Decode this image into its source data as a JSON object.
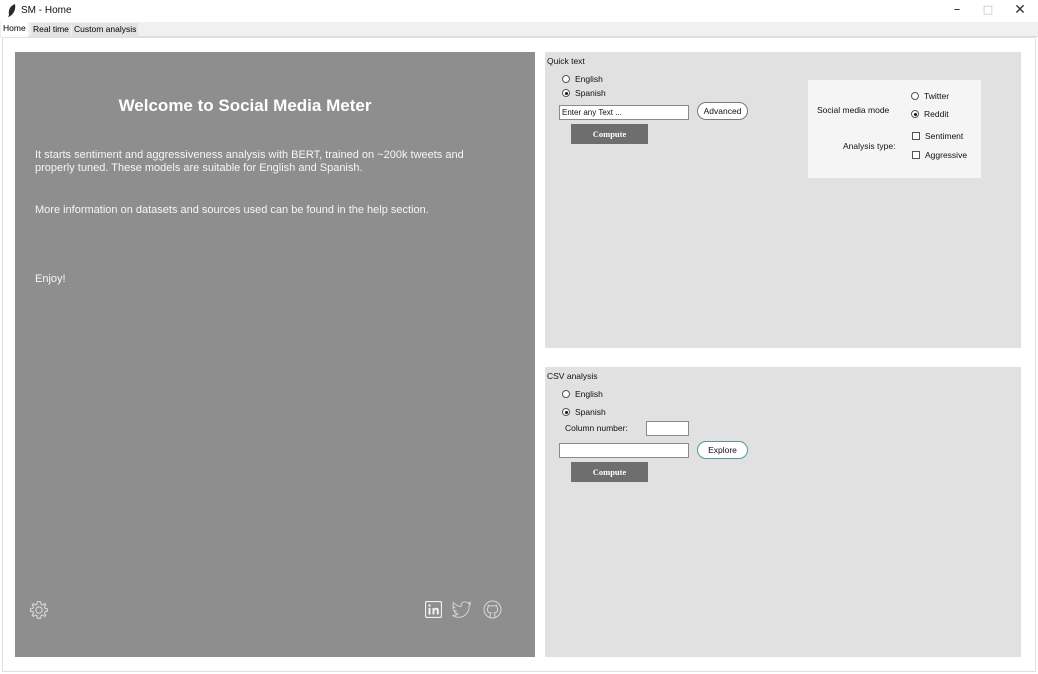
{
  "window": {
    "title": "SM - Home",
    "minimize": "–",
    "maximize": "□",
    "close": "✕"
  },
  "tabs": [
    {
      "label": "Home",
      "active": true
    },
    {
      "label": "Real time",
      "active": false
    },
    {
      "label": "Custom analysis",
      "active": false
    }
  ],
  "welcome": {
    "title": "Welcome to Social Media Meter",
    "paragraph1": "It starts sentiment and aggressiveness analysis with BERT, trained on ~200k tweets and properly tuned. These models are suitable for English and Spanish.",
    "paragraph2": "More information on datasets and sources used can be found in the help section.",
    "paragraph3": "Enjoy!",
    "icons": [
      "gear-icon",
      "linkedin-icon",
      "twitter-icon",
      "github-icon"
    ]
  },
  "quick_text": {
    "label": "Quick text",
    "languages": [
      {
        "label": "English",
        "selected": false
      },
      {
        "label": "Spanish",
        "selected": true
      }
    ],
    "input_value": "Enter any Text ...",
    "advanced_label": "Advanced",
    "compute_label": "Compute",
    "options": {
      "social_media_mode_label": "Social media mode",
      "modes": [
        {
          "label": "Twitter",
          "selected": false
        },
        {
          "label": "Reddit",
          "selected": true
        }
      ],
      "analysis_type_label": "Analysis type:",
      "types": [
        {
          "label": "Sentiment",
          "checked": false
        },
        {
          "label": "Aggressive",
          "checked": false
        }
      ]
    }
  },
  "csv_analysis": {
    "label": "CSV analysis",
    "languages": [
      {
        "label": "English",
        "selected": false
      },
      {
        "label": "Spanish",
        "selected": true
      }
    ],
    "column_number_label": "Column number:",
    "column_number_value": "",
    "file_path_value": "",
    "explore_label": "Explore",
    "compute_label": "Compute"
  },
  "colors": {
    "welcome_bg": "#8e8e8e",
    "panel_bg": "#e1e1e1",
    "compute_bg": "#6e6e6e",
    "explore_border": "#4f9a9a"
  }
}
